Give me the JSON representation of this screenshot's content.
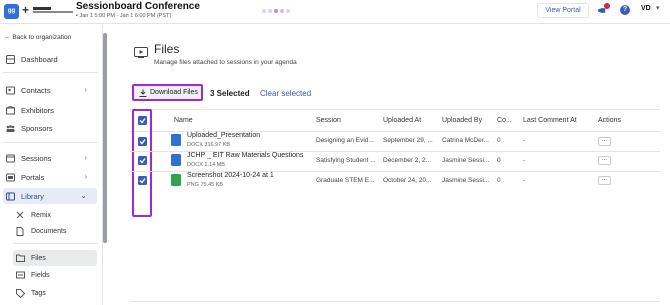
{
  "app": {
    "conference_title": "Sessionboard Conference",
    "dates": "Jan 1 5:00 PM - Jan 1 6:00 PM (PST)",
    "logo_text": "gg",
    "view_portal_label": "View Portal",
    "avatar_initials": "VD",
    "colors": {
      "accent": "#3b5bb8",
      "highlight": "#9c2bd6",
      "active_bg": "#e8ebf3"
    }
  },
  "sidebar": {
    "back_label": "Back to organization",
    "items": [
      {
        "label": "Dashboard",
        "icon": "dashboard-icon"
      },
      {
        "label": "Contacts",
        "icon": "contacts-icon"
      },
      {
        "label": "Exhibitors",
        "icon": "exhibitors-icon"
      },
      {
        "label": "Sponsors",
        "icon": "sponsors-icon"
      },
      {
        "label": "Sessions",
        "icon": "sessions-icon"
      },
      {
        "label": "Portals",
        "icon": "portals-icon"
      },
      {
        "label": "Library",
        "icon": "library-icon"
      },
      {
        "label": "Remix",
        "icon": "remix-icon"
      },
      {
        "label": "Documents",
        "icon": "documents-icon"
      },
      {
        "label": "Files",
        "icon": "files-icon"
      },
      {
        "label": "Fields",
        "icon": "fields-icon"
      },
      {
        "label": "Tags",
        "icon": "tags-icon"
      }
    ]
  },
  "main": {
    "title": "Files",
    "subtitle": "Manage files attached to sessions in your agenda",
    "download_label": "Download Files",
    "selected_count": "3 Selected",
    "clear_label": "Clear selected",
    "columns": [
      "Name",
      "Session",
      "Uploaded At",
      "Uploaded By",
      "Co...",
      "Last Comment At",
      "Actions"
    ],
    "rows": [
      {
        "name": "Uploaded_Presentation",
        "meta": "DOCX 316.97 KB",
        "type": "docx",
        "session": "Designing an Evid...",
        "uploaded_at": "September 29, ...",
        "uploaded_by": "Catrina McDer...",
        "comments": "0",
        "last_comment": "-",
        "action": "..."
      },
      {
        "name": "JCHP _ EIT Raw Materials Questions",
        "meta": "DOCX 1.14 MB",
        "type": "docx",
        "session": "Satisfying Student ...",
        "uploaded_at": "December 2, 2...",
        "uploaded_by": "Jasmine Sessi...",
        "comments": "0",
        "last_comment": "-",
        "action": "..."
      },
      {
        "name": "Screenshot 2024-10-24 at 1",
        "meta": "PNG 75.45 KB",
        "type": "png",
        "session": "Graduate STEM E...",
        "uploaded_at": "October 24, 20...",
        "uploaded_by": "Jasmine Sessi...",
        "comments": "0",
        "last_comment": "-",
        "action": "..."
      }
    ]
  }
}
